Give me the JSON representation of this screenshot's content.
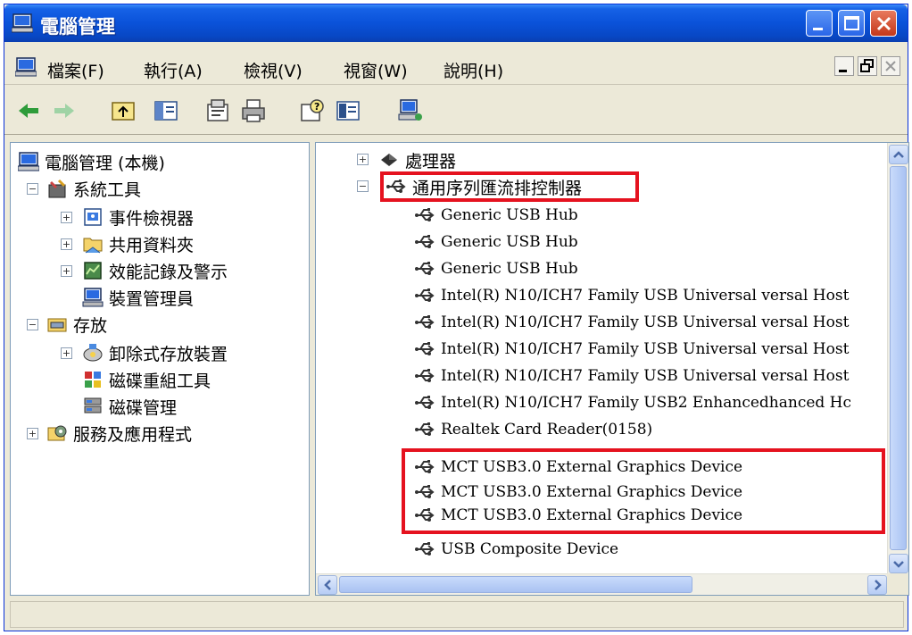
{
  "window": {
    "title": "電腦管理",
    "accent": "#0a52d9",
    "highlight_color": "#e5121f"
  },
  "title_buttons": [
    "minimize-icon",
    "maximize-icon",
    "close-icon"
  ],
  "menu": {
    "items": [
      "檔案(F)",
      "執行(A)",
      "檢視(V)",
      "視窗(W)",
      "說明(H)"
    ]
  },
  "toolbar": {
    "icons": [
      "back-arrow-icon",
      "forward-arrow-icon",
      "up-folder-icon",
      "show-hide-tree-icon",
      "properties-icon",
      "print-icon",
      "help-icon",
      "console-icon",
      "computer-icon"
    ]
  },
  "left_tree": {
    "items": [
      {
        "label": "電腦管理 (本機)",
        "icon": "computer-icon"
      },
      {
        "label": "系統工具",
        "icon": "tools-icon"
      },
      {
        "label": "事件檢視器",
        "icon": "event-viewer-icon"
      },
      {
        "label": "共用資料夾",
        "icon": "shared-folder-icon"
      },
      {
        "label": "效能記錄及警示",
        "icon": "performance-icon"
      },
      {
        "label": "裝置管理員",
        "icon": "device-manager-icon"
      },
      {
        "label": "存放",
        "icon": "storage-icon"
      },
      {
        "label": "卸除式存放裝置",
        "icon": "removable-storage-icon"
      },
      {
        "label": "磁碟重組工具",
        "icon": "defrag-icon"
      },
      {
        "label": "磁碟管理",
        "icon": "disk-management-icon"
      },
      {
        "label": "服務及應用程式",
        "icon": "services-icon"
      }
    ]
  },
  "right_tree": {
    "items": [
      {
        "label": "處理器",
        "icon": "processor-icon"
      },
      {
        "label": "通用序列匯流排控制器",
        "icon": "usb-icon"
      },
      {
        "label": "Generic USB Hub",
        "icon": "usb-icon"
      },
      {
        "label": "Generic USB Hub",
        "icon": "usb-icon"
      },
      {
        "label": "Generic USB Hub",
        "icon": "usb-icon"
      },
      {
        "label": "Intel(R) N10/ICH7 Family USB Universal versal Host",
        "icon": "usb-icon"
      },
      {
        "label": "Intel(R) N10/ICH7 Family USB Universal versal Host",
        "icon": "usb-icon"
      },
      {
        "label": "Intel(R) N10/ICH7 Family USB Universal versal Host",
        "icon": "usb-icon"
      },
      {
        "label": "Intel(R) N10/ICH7 Family USB Universal versal Host",
        "icon": "usb-icon"
      },
      {
        "label": "Intel(R) N10/ICH7 Family USB2 Enhancedhanced Hc",
        "icon": "usb-icon"
      },
      {
        "label": "Realtek Card Reader(0158)",
        "icon": "usb-icon"
      },
      {
        "label": "MCT USB3.0 External Graphics Device",
        "icon": "usb-icon"
      },
      {
        "label": "MCT USB3.0 External Graphics Device",
        "icon": "usb-icon"
      },
      {
        "label": "MCT USB3.0 External Graphics Device",
        "icon": "usb-icon"
      },
      {
        "label": "USB Composite Device",
        "icon": "usb-icon"
      }
    ]
  },
  "statusbar": {
    "text": ""
  }
}
